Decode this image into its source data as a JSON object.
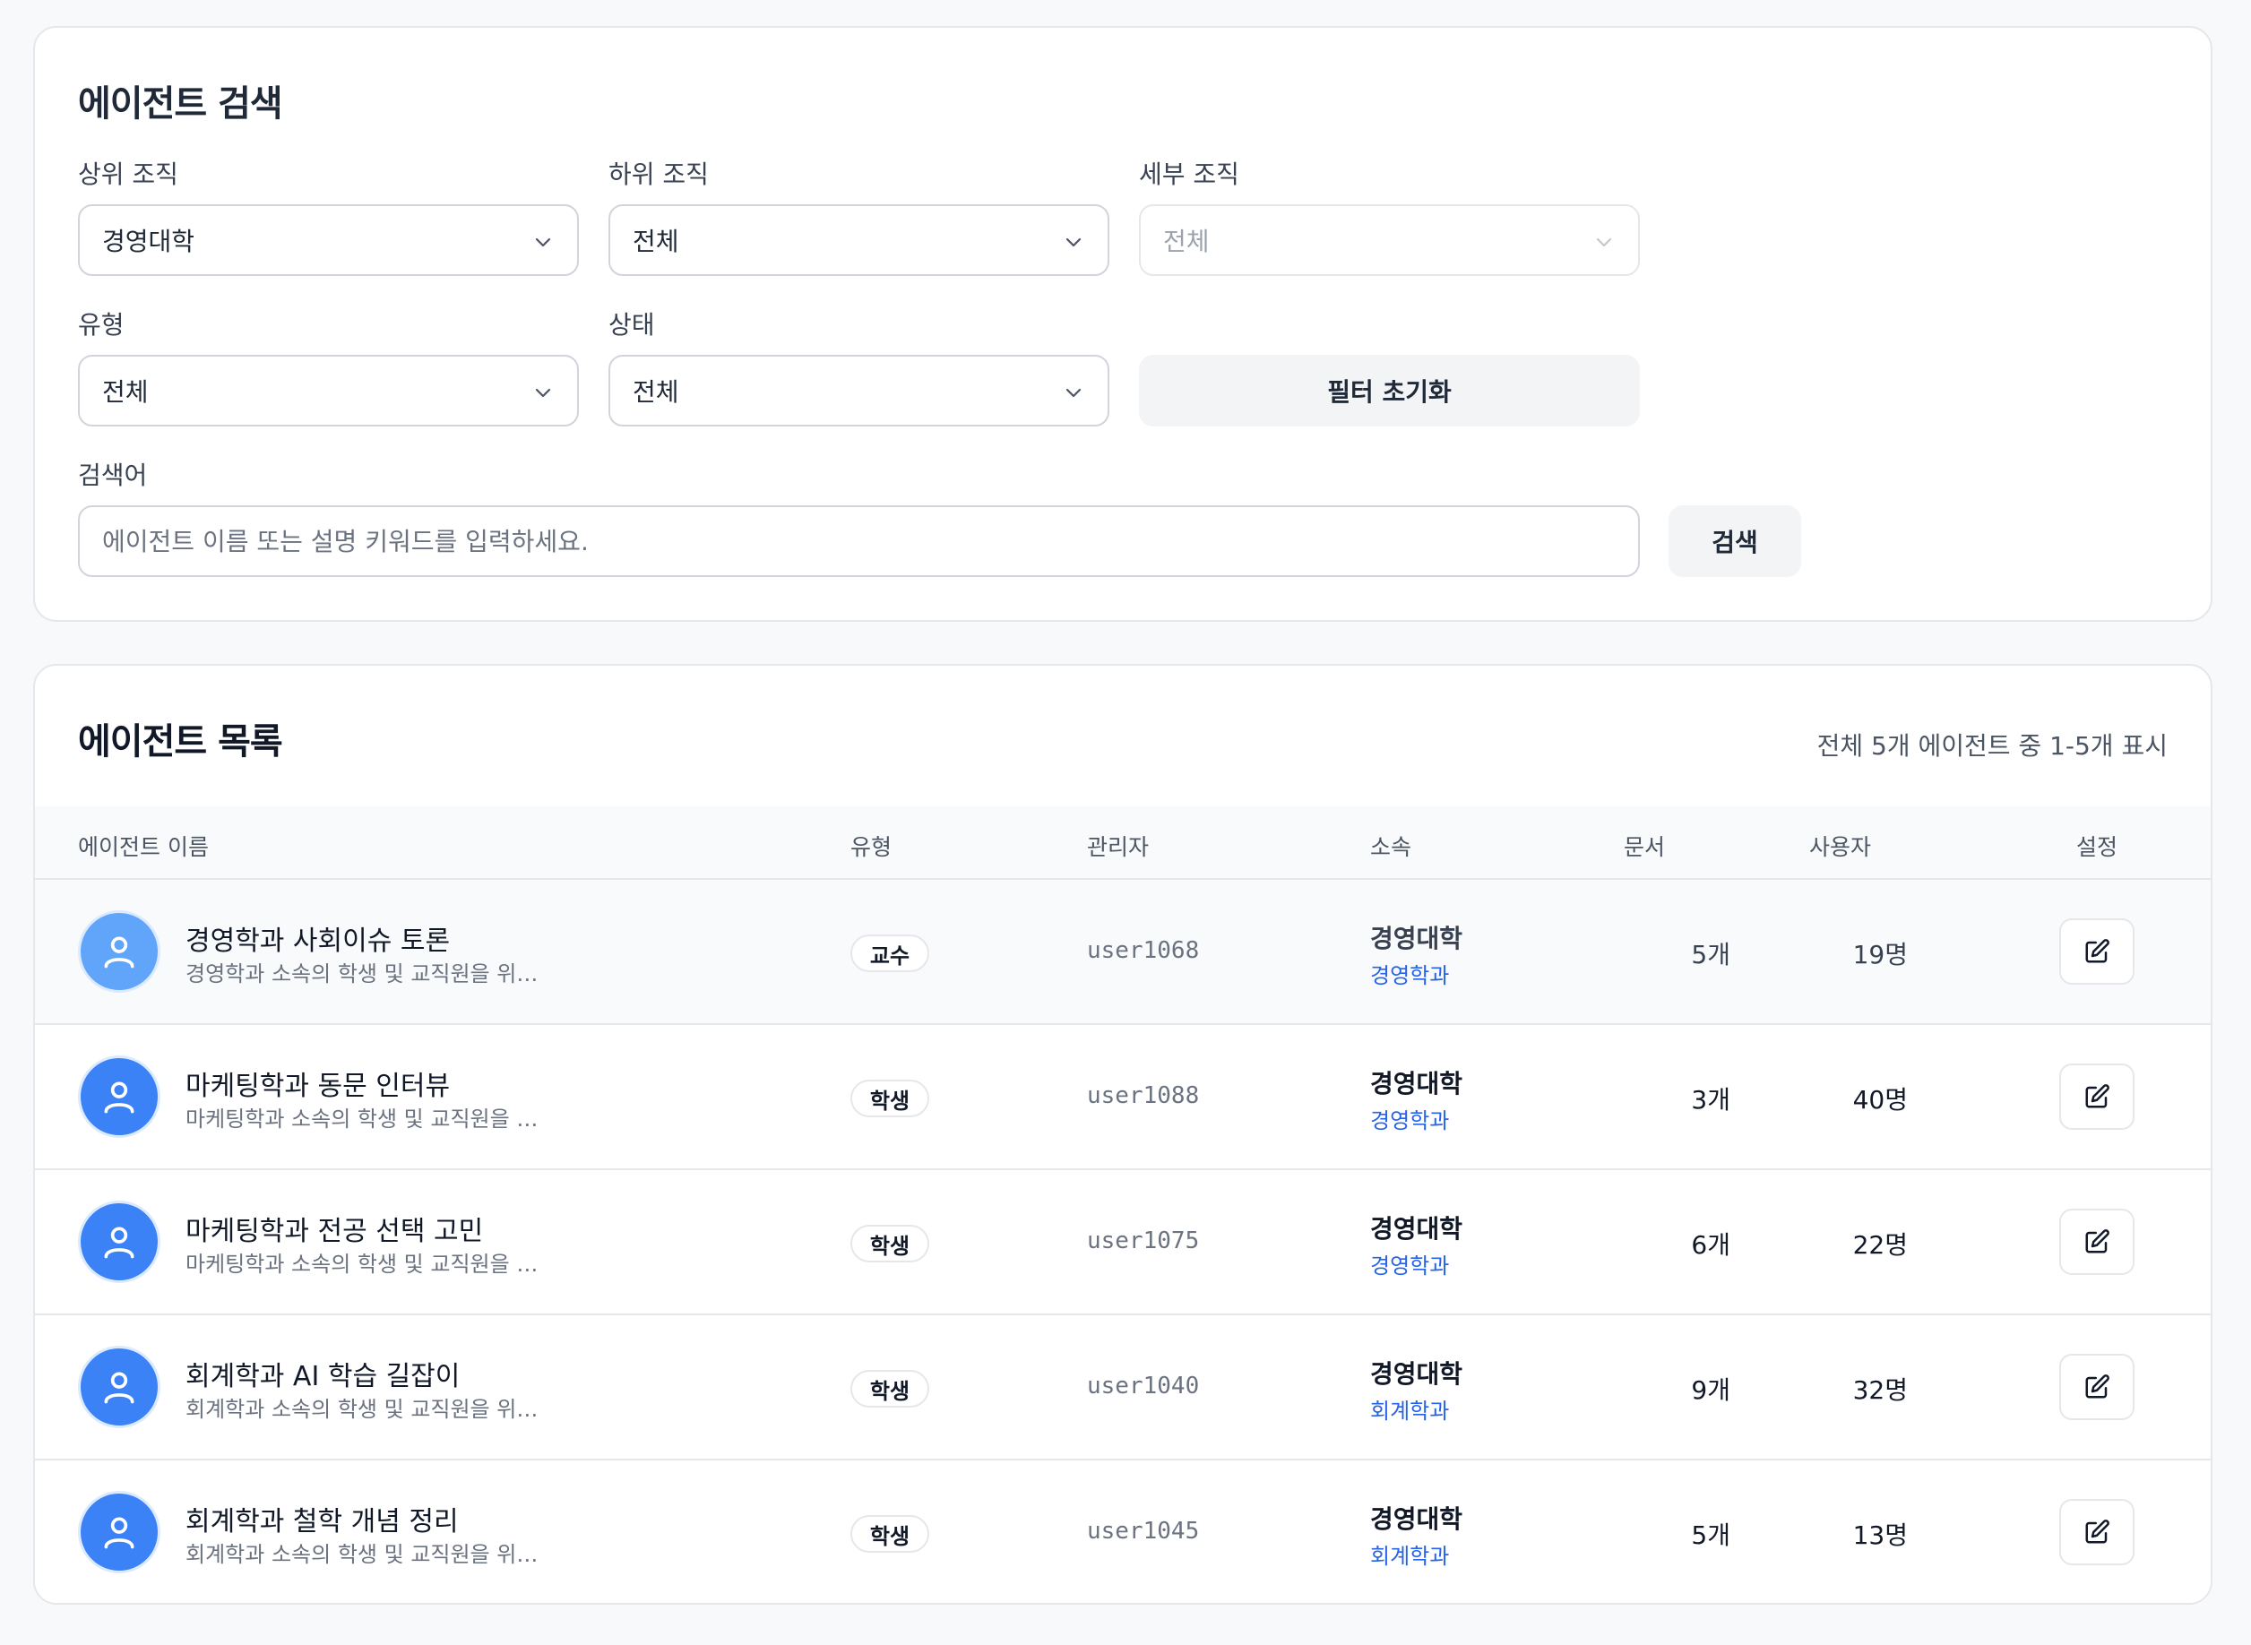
{
  "search": {
    "title": "에이전트 검색",
    "parent_org": {
      "label": "상위 조직",
      "value": "경영대학"
    },
    "sub_org": {
      "label": "하위 조직",
      "value": "전체"
    },
    "detail_org": {
      "label": "세부 조직",
      "value": "전체"
    },
    "type": {
      "label": "유형",
      "value": "전체"
    },
    "status": {
      "label": "상태",
      "value": "전체"
    },
    "reset_button": "필터 초기화",
    "keyword": {
      "label": "검색어",
      "placeholder": "에이전트 이름 또는 설명 키워드를 입력하세요."
    },
    "search_button": "검색"
  },
  "list": {
    "title": "에이전트 목록",
    "summary": "전체 5개 에이전트 중 1-5개 표시",
    "columns": {
      "name": "에이전트 이름",
      "type": "유형",
      "manager": "관리자",
      "org": "소속",
      "docs": "문서",
      "users": "사용자",
      "settings": "설정"
    },
    "rows": [
      {
        "name": "경영학과 사회이슈 토론",
        "desc": "경영학과 소속의 학생 및 교직원을 위한 에이전트",
        "type": "교수",
        "manager": "user1068",
        "org": "경영대학",
        "dept": "경영학과",
        "docs": "5개",
        "users": "19명"
      },
      {
        "name": "마케팅학과 동문 인터뷰",
        "desc": "마케팅학과 소속의 학생 및 교직원을 위한 에이전트",
        "type": "학생",
        "manager": "user1088",
        "org": "경영대학",
        "dept": "경영학과",
        "docs": "3개",
        "users": "40명"
      },
      {
        "name": "마케팅학과 전공 선택 고민",
        "desc": "마케팅학과 소속의 학생 및 교직원을 위한 에이전트",
        "type": "학생",
        "manager": "user1075",
        "org": "경영대학",
        "dept": "경영학과",
        "docs": "6개",
        "users": "22명"
      },
      {
        "name": "회계학과 AI 학습 길잡이",
        "desc": "회계학과 소속의 학생 및 교직원을 위한 에이전트",
        "type": "학생",
        "manager": "user1040",
        "org": "경영대학",
        "dept": "회계학과",
        "docs": "9개",
        "users": "32명"
      },
      {
        "name": "회계학과 철학 개념 정리",
        "desc": "회계학과 소속의 학생 및 교직원을 위한 에이전트",
        "type": "학생",
        "manager": "user1045",
        "org": "경영대학",
        "dept": "회계학과",
        "docs": "5개",
        "users": "13명"
      }
    ]
  },
  "icons": {
    "chevron": "chevron-down-icon",
    "avatar": "user-icon",
    "edit": "edit-icon"
  },
  "colors": {
    "accent": "#3b82f6",
    "link": "#2563eb"
  }
}
